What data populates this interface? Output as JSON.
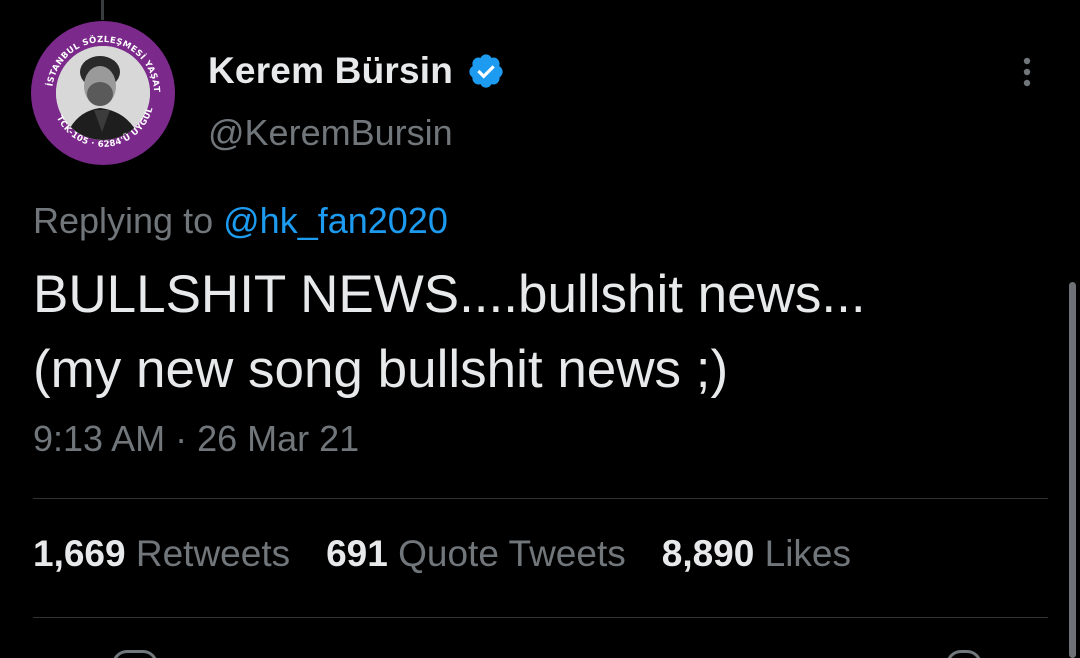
{
  "author": {
    "display_name": "Kerem Bürsin",
    "handle": "@KeremBursin",
    "verified": true,
    "avatar_ring_text_top": "İSTANBUL SÖZLEŞMESİ YAŞATIR",
    "avatar_ring_text_left": "TCK-105",
    "avatar_ring_text_bottom": "6284'Ü UYGULA",
    "avatar_ring_color": "#7b2a8c"
  },
  "reply": {
    "prefix": "Replying to",
    "mention": "@hk_fan2020"
  },
  "tweet": {
    "line1": "BULLSHIT NEWS....bullshit news...",
    "line2": "(my new song bullshit news ;)",
    "timestamp": "9:13 AM · 26 Mar 21"
  },
  "stats": {
    "retweets_count": "1,669",
    "retweets_label": "Retweets",
    "quotes_count": "691",
    "quotes_label": "Quote Tweets",
    "likes_count": "8,890",
    "likes_label": "Likes"
  },
  "icons": {
    "verified": "verified-badge-icon",
    "more": "more-options-icon"
  },
  "colors": {
    "background": "#000000",
    "primary_text": "#e7e9ea",
    "secondary_text": "#71767b",
    "link": "#1d9bf0",
    "divider": "#2f3336"
  }
}
